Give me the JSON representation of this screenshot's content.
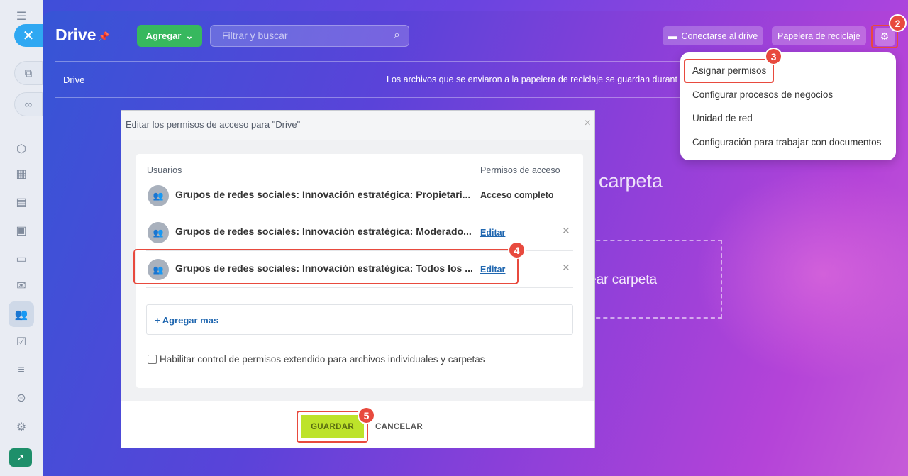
{
  "panel": {
    "title": "Drive",
    "add_label": "Agregar",
    "search_placeholder": "Filtrar y buscar",
    "connect_label": "Conectarse al drive",
    "trash_label": "Papelera de reciclaje",
    "breadcrumb": "Drive",
    "trash_note": "Los archivos que se enviaron a la papelera de reciclaje se guardan durant",
    "bg_folder_text": "carpeta",
    "bg_create_text": "ear carpeta"
  },
  "menu": {
    "items": [
      {
        "label": "Asignar permisos"
      },
      {
        "label": "Configurar procesos de negocios"
      },
      {
        "label": "Unidad de red"
      },
      {
        "label": "Configuración para trabajar con documentos"
      }
    ]
  },
  "modal": {
    "title": "Editar los permisos de acceso para \"Drive\"",
    "col_users": "Usuarios",
    "col_perms": "Permisos de acceso",
    "rows": [
      {
        "name": "Grupos de redes sociales: Innovación estratégica: Propietari...",
        "perm": "Acceso completo"
      },
      {
        "name": "Grupos de redes sociales: Innovación estratégica: Moderado...",
        "perm": "Editar"
      },
      {
        "name": "Grupos de redes sociales: Innovación estratégica: Todos los ...",
        "perm": "Editar"
      }
    ],
    "add_more": "+ Agregar mas",
    "checkbox_label": "Habilitar control de permisos extendido para archivos individuales y carpetas",
    "save_label": "GUARDAR",
    "cancel_label": "CANCELAR"
  },
  "markers": [
    "2",
    "3",
    "4",
    "5"
  ],
  "colors": {
    "accent_red": "#e84a3e",
    "add_green": "#37b85e",
    "save_lime": "#bde32a",
    "link_blue": "#2067b0"
  }
}
